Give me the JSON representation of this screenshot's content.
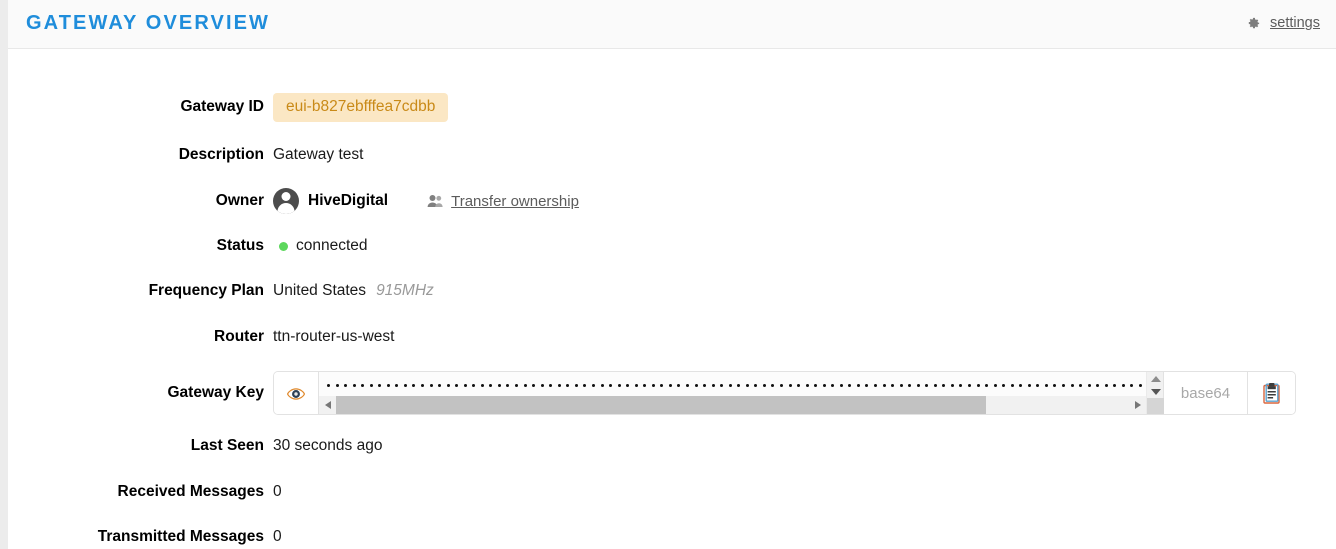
{
  "header": {
    "title": "Gateway Overview",
    "settings_label": "settings",
    "gear_icon": "gear-icon",
    "accent_color": "#1f8ddb"
  },
  "fields": {
    "gateway_id": {
      "label": "Gateway ID",
      "value": "eui-b827ebfffea7cdbb",
      "badge_bg": "#fbe7c4",
      "badge_text_color": "#c98a18"
    },
    "description": {
      "label": "Description",
      "value": "Gateway test"
    },
    "owner": {
      "label": "Owner",
      "name": "HiveDigital",
      "avatar_icon": "avatar",
      "transfer_icon": "users-icon",
      "transfer_label": "Transfer ownership"
    },
    "status": {
      "label": "Status",
      "value": "connected",
      "dot_color": "#5cd75c"
    },
    "frequency_plan": {
      "label": "Frequency Plan",
      "region": "United States",
      "band": "915MHz"
    },
    "router": {
      "label": "Router",
      "value": "ttn-router-us-west"
    },
    "gateway_key": {
      "label": "Gateway Key",
      "reveal_icon": "eye-icon",
      "masked": true,
      "masked_dot_count": 140,
      "format_label": "base64",
      "copy_icon": "clipboard-icon"
    },
    "last_seen": {
      "label": "Last Seen",
      "value": "30 seconds ago"
    },
    "received_messages": {
      "label": "Received Messages",
      "value": "0"
    },
    "transmitted_messages": {
      "label": "Transmitted Messages",
      "value": "0"
    }
  }
}
